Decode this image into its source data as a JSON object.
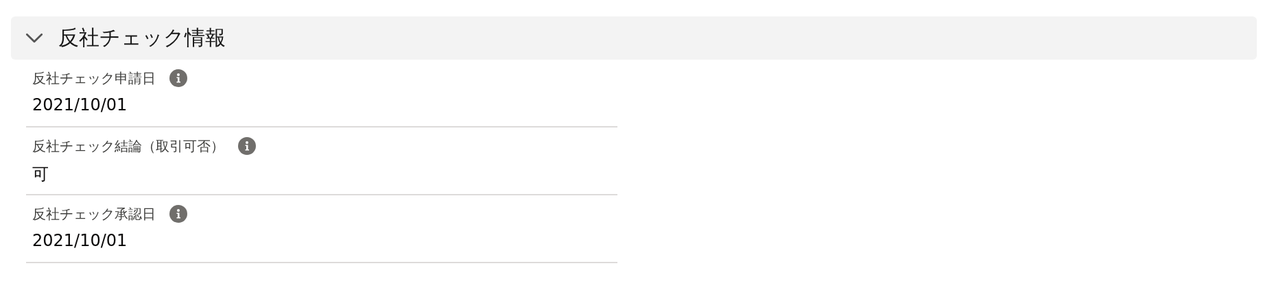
{
  "section": {
    "title": "反社チェック情報",
    "expanded": true
  },
  "fields": [
    {
      "label": "反社チェック申請日",
      "value": "2021/10/01"
    },
    {
      "label": "反社チェック結論（取引可否）",
      "value": "可"
    },
    {
      "label": "反社チェック承認日",
      "value": "2021/10/01"
    }
  ]
}
